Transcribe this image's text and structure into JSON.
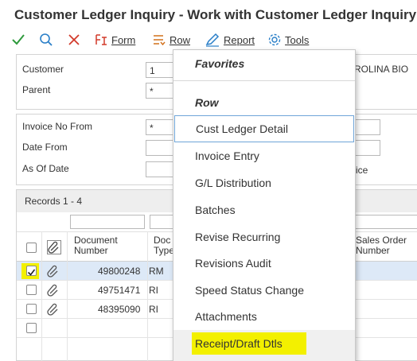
{
  "title": "Customer Ledger Inquiry - Work with Customer Ledger Inquiry",
  "toolbar": {
    "ok_icon": "checkmark-icon",
    "find_icon": "search-icon",
    "close_icon": "close-icon",
    "form_label": "Form",
    "row_label": "Row",
    "report_label": "Report",
    "tools_label": "Tools"
  },
  "header_form": {
    "customer_label": "Customer",
    "customer_value": "1",
    "customer_name": "ROLINA BIO",
    "parent_label": "Parent",
    "parent_value": "*"
  },
  "search_form": {
    "invoice_from_label": "Invoice No From",
    "invoice_from_value": "*",
    "date_from_label": "Date From",
    "as_of_date_label": "As Of Date",
    "trailing_text": "ice"
  },
  "grid": {
    "records": "Records 1 - 4",
    "columns": {
      "document_number": "Document Number",
      "doc_type": "Doc Type",
      "sales_order_number": "Sales Order Number"
    },
    "rows": [
      {
        "checked": true,
        "doc": "49800248",
        "type": "RM"
      },
      {
        "checked": false,
        "doc": "49751471",
        "type": "RI"
      },
      {
        "checked": false,
        "doc": "48395090",
        "type": "RI"
      },
      {
        "checked": false,
        "doc": "",
        "type": ""
      }
    ]
  },
  "row_menu": {
    "favorites_heading": "Favorites",
    "row_heading": "Row",
    "items": [
      "Cust Ledger Detail",
      "Invoice Entry",
      "G/L Distribution",
      "Batches",
      "Revise Recurring",
      "Revisions Audit",
      "Speed Status Change",
      "Attachments",
      "Receipt/Draft Dtls"
    ],
    "highlight_color": "#f3f000"
  }
}
